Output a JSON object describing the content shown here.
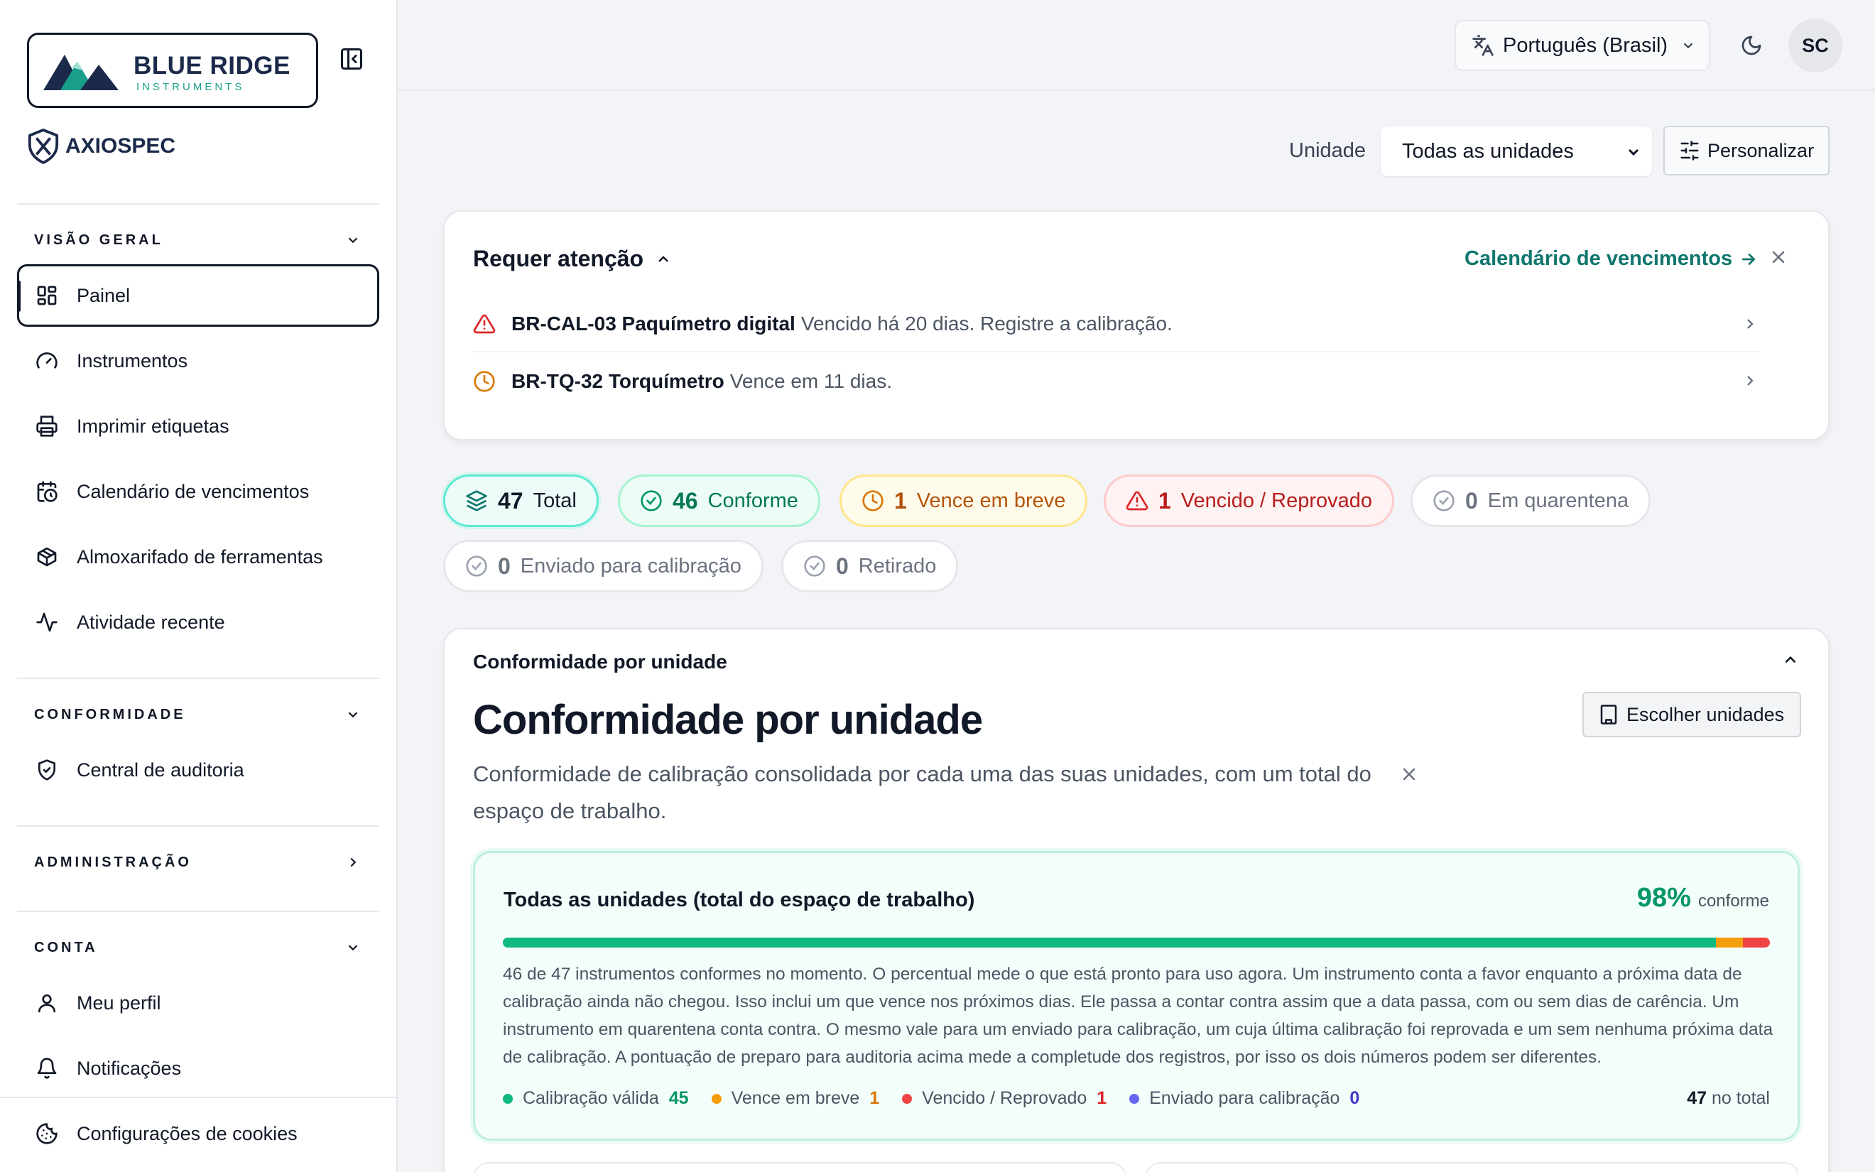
{
  "brand": {
    "logo_title": "BLUE RIDGE",
    "logo_subtitle": "INSTRUMENTS",
    "product": "AXIOSPEC"
  },
  "sidebar": {
    "sections": [
      {
        "title": "VISÃO GERAL",
        "expanded": true,
        "items": [
          {
            "label": "Painel",
            "icon": "layout-grid-icon",
            "active": true
          },
          {
            "label": "Instrumentos",
            "icon": "gauge-icon"
          },
          {
            "label": "Imprimir etiquetas",
            "icon": "printer-icon"
          },
          {
            "label": "Calendário de vencimentos",
            "icon": "calendar-clock-icon"
          },
          {
            "label": "Almoxarifado de ferramentas",
            "icon": "package-icon"
          },
          {
            "label": "Atividade recente",
            "icon": "activity-icon"
          }
        ]
      },
      {
        "title": "CONFORMIDADE",
        "expanded": true,
        "items": [
          {
            "label": "Central de auditoria",
            "icon": "shield-check-icon"
          }
        ]
      },
      {
        "title": "ADMINISTRAÇÃO",
        "expanded": false,
        "items": []
      },
      {
        "title": "CONTA",
        "expanded": true,
        "items": [
          {
            "label": "Meu perfil",
            "icon": "user-icon"
          },
          {
            "label": "Notificações",
            "icon": "bell-icon"
          }
        ]
      }
    ],
    "footer_item": {
      "label": "Configurações de cookies",
      "icon": "cookie-icon"
    }
  },
  "topbar": {
    "language": "Português (Brasil)",
    "avatar_initials": "SC"
  },
  "filters": {
    "unit_label": "Unidade",
    "unit_value": "Todas as unidades",
    "customize_label": "Personalizar"
  },
  "attention": {
    "title": "Requer atenção",
    "link_label": "Calendário de vencimentos",
    "items": [
      {
        "code": "BR-CAL-03 Paquímetro digital",
        "message": "Vencido há 20 dias. Registre a calibração.",
        "severity": "danger"
      },
      {
        "code": "BR-TQ-32 Torquímetro",
        "message": "Vence em 11 dias.",
        "severity": "warning"
      }
    ]
  },
  "status_chips": [
    {
      "count": "47",
      "label": "Total",
      "kind": "total"
    },
    {
      "count": "46",
      "label": "Conforme",
      "kind": "ok"
    },
    {
      "count": "1",
      "label": "Vence em breve",
      "kind": "warn"
    },
    {
      "count": "1",
      "label": "Vencido / Reprovado",
      "kind": "danger"
    },
    {
      "count": "0",
      "label": "Em quarentena",
      "kind": "neutral"
    },
    {
      "count": "0",
      "label": "Enviado para calibração",
      "kind": "neutral"
    },
    {
      "count": "0",
      "label": "Retirado",
      "kind": "neutral"
    }
  ],
  "compliance": {
    "section_header": "Conformidade por unidade",
    "heading": "Conformidade por unidade",
    "choose_units_label": "Escolher unidades",
    "description": "Conformidade de calibração consolidada por cada uma das suas unidades, com um total do espaço de trabalho.",
    "summary": {
      "title": "Todas as unidades (total do espaço de trabalho)",
      "percent": "98%",
      "percent_label": "conforme",
      "explanation": "46 de 47 instrumentos conformes no momento. O percentual mede o que está pronto para uso agora. Um instrumento conta a favor enquanto a próxima data de calibração ainda não chegou. Isso inclui um que vence nos próximos dias. Ele passa a contar contra assim que a data passa, com ou sem dias de carência. Um instrumento em quarentena conta contra. O mesmo vale para um enviado para calibração, um cuja última calibração foi reprovada e um sem nenhuma próxima data de calibração. A pontuação de preparo para auditoria acima mede a completude dos registros, por isso os dois números podem ser diferentes.",
      "legend": [
        {
          "label": "Calibração válida",
          "value": "45",
          "color": "#10b981"
        },
        {
          "label": "Vence em breve",
          "value": "1",
          "color": "#f59e0b"
        },
        {
          "label": "Vencido / Reprovado",
          "value": "1",
          "color": "#ef4444"
        },
        {
          "label": "Enviado para calibração",
          "value": "0",
          "color": "#6366f1"
        }
      ],
      "total_value": "47",
      "total_label": "no total"
    }
  }
}
